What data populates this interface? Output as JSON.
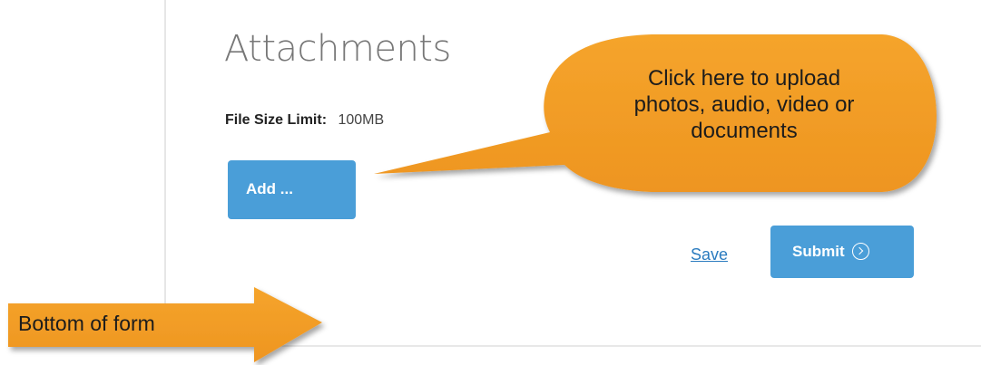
{
  "section": {
    "title": "Attachments",
    "file_size_label": "File Size Limit:",
    "file_size_value": "100MB"
  },
  "buttons": {
    "add_label": "Add ...",
    "save_label": "Save",
    "submit_label": "Submit"
  },
  "annotations": {
    "callout_lines": [
      "Click here to upload",
      "photos, audio, video or",
      "documents"
    ],
    "arrow_label": "Bottom of form"
  },
  "colors": {
    "button_blue": "#4a9ed8",
    "link_blue": "#2a7bbf",
    "annotation_orange": "#f29c23"
  },
  "icons": {
    "submit": "chevron-right-circle-icon"
  }
}
